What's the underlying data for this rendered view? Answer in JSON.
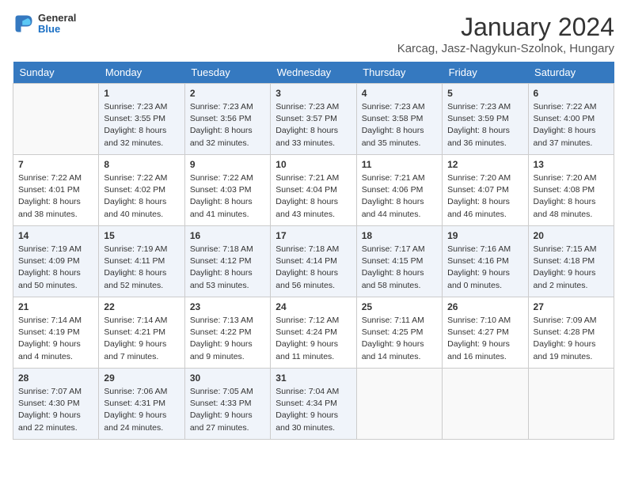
{
  "header": {
    "logo_general": "General",
    "logo_blue": "Blue",
    "title": "January 2024",
    "subtitle": "Karcag, Jasz-Nagykun-Szolnok, Hungary"
  },
  "days_of_week": [
    "Sunday",
    "Monday",
    "Tuesday",
    "Wednesday",
    "Thursday",
    "Friday",
    "Saturday"
  ],
  "weeks": [
    [
      {
        "day": "",
        "info": ""
      },
      {
        "day": "1",
        "info": "Sunrise: 7:23 AM\nSunset: 3:55 PM\nDaylight: 8 hours\nand 32 minutes."
      },
      {
        "day": "2",
        "info": "Sunrise: 7:23 AM\nSunset: 3:56 PM\nDaylight: 8 hours\nand 32 minutes."
      },
      {
        "day": "3",
        "info": "Sunrise: 7:23 AM\nSunset: 3:57 PM\nDaylight: 8 hours\nand 33 minutes."
      },
      {
        "day": "4",
        "info": "Sunrise: 7:23 AM\nSunset: 3:58 PM\nDaylight: 8 hours\nand 35 minutes."
      },
      {
        "day": "5",
        "info": "Sunrise: 7:23 AM\nSunset: 3:59 PM\nDaylight: 8 hours\nand 36 minutes."
      },
      {
        "day": "6",
        "info": "Sunrise: 7:22 AM\nSunset: 4:00 PM\nDaylight: 8 hours\nand 37 minutes."
      }
    ],
    [
      {
        "day": "7",
        "info": "Sunrise: 7:22 AM\nSunset: 4:01 PM\nDaylight: 8 hours\nand 38 minutes."
      },
      {
        "day": "8",
        "info": "Sunrise: 7:22 AM\nSunset: 4:02 PM\nDaylight: 8 hours\nand 40 minutes."
      },
      {
        "day": "9",
        "info": "Sunrise: 7:22 AM\nSunset: 4:03 PM\nDaylight: 8 hours\nand 41 minutes."
      },
      {
        "day": "10",
        "info": "Sunrise: 7:21 AM\nSunset: 4:04 PM\nDaylight: 8 hours\nand 43 minutes."
      },
      {
        "day": "11",
        "info": "Sunrise: 7:21 AM\nSunset: 4:06 PM\nDaylight: 8 hours\nand 44 minutes."
      },
      {
        "day": "12",
        "info": "Sunrise: 7:20 AM\nSunset: 4:07 PM\nDaylight: 8 hours\nand 46 minutes."
      },
      {
        "day": "13",
        "info": "Sunrise: 7:20 AM\nSunset: 4:08 PM\nDaylight: 8 hours\nand 48 minutes."
      }
    ],
    [
      {
        "day": "14",
        "info": "Sunrise: 7:19 AM\nSunset: 4:09 PM\nDaylight: 8 hours\nand 50 minutes."
      },
      {
        "day": "15",
        "info": "Sunrise: 7:19 AM\nSunset: 4:11 PM\nDaylight: 8 hours\nand 52 minutes."
      },
      {
        "day": "16",
        "info": "Sunrise: 7:18 AM\nSunset: 4:12 PM\nDaylight: 8 hours\nand 53 minutes."
      },
      {
        "day": "17",
        "info": "Sunrise: 7:18 AM\nSunset: 4:14 PM\nDaylight: 8 hours\nand 56 minutes."
      },
      {
        "day": "18",
        "info": "Sunrise: 7:17 AM\nSunset: 4:15 PM\nDaylight: 8 hours\nand 58 minutes."
      },
      {
        "day": "19",
        "info": "Sunrise: 7:16 AM\nSunset: 4:16 PM\nDaylight: 9 hours\nand 0 minutes."
      },
      {
        "day": "20",
        "info": "Sunrise: 7:15 AM\nSunset: 4:18 PM\nDaylight: 9 hours\nand 2 minutes."
      }
    ],
    [
      {
        "day": "21",
        "info": "Sunrise: 7:14 AM\nSunset: 4:19 PM\nDaylight: 9 hours\nand 4 minutes."
      },
      {
        "day": "22",
        "info": "Sunrise: 7:14 AM\nSunset: 4:21 PM\nDaylight: 9 hours\nand 7 minutes."
      },
      {
        "day": "23",
        "info": "Sunrise: 7:13 AM\nSunset: 4:22 PM\nDaylight: 9 hours\nand 9 minutes."
      },
      {
        "day": "24",
        "info": "Sunrise: 7:12 AM\nSunset: 4:24 PM\nDaylight: 9 hours\nand 11 minutes."
      },
      {
        "day": "25",
        "info": "Sunrise: 7:11 AM\nSunset: 4:25 PM\nDaylight: 9 hours\nand 14 minutes."
      },
      {
        "day": "26",
        "info": "Sunrise: 7:10 AM\nSunset: 4:27 PM\nDaylight: 9 hours\nand 16 minutes."
      },
      {
        "day": "27",
        "info": "Sunrise: 7:09 AM\nSunset: 4:28 PM\nDaylight: 9 hours\nand 19 minutes."
      }
    ],
    [
      {
        "day": "28",
        "info": "Sunrise: 7:07 AM\nSunset: 4:30 PM\nDaylight: 9 hours\nand 22 minutes."
      },
      {
        "day": "29",
        "info": "Sunrise: 7:06 AM\nSunset: 4:31 PM\nDaylight: 9 hours\nand 24 minutes."
      },
      {
        "day": "30",
        "info": "Sunrise: 7:05 AM\nSunset: 4:33 PM\nDaylight: 9 hours\nand 27 minutes."
      },
      {
        "day": "31",
        "info": "Sunrise: 7:04 AM\nSunset: 4:34 PM\nDaylight: 9 hours\nand 30 minutes."
      },
      {
        "day": "",
        "info": ""
      },
      {
        "day": "",
        "info": ""
      },
      {
        "day": "",
        "info": ""
      }
    ]
  ]
}
